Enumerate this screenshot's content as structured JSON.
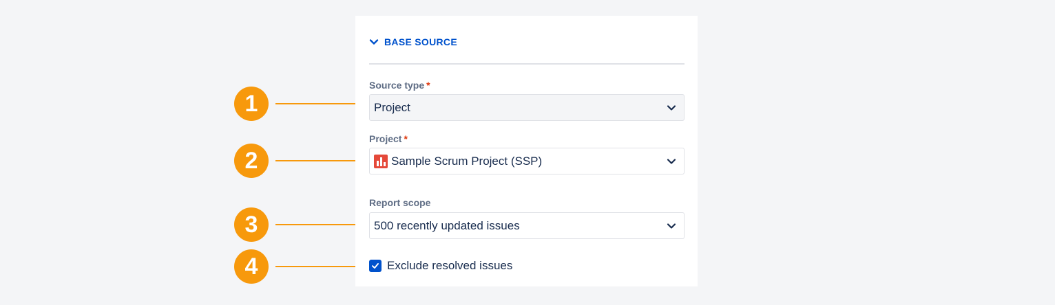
{
  "section": {
    "title": "BASE SOURCE",
    "expanded": true,
    "accent_color": "#0052cc"
  },
  "fields": {
    "source_type": {
      "label": "Source type",
      "required_mark": "*",
      "value": "Project"
    },
    "project": {
      "label": "Project",
      "required_mark": "*",
      "value": "Sample Scrum Project (SSP)",
      "icon": "project-avatar-icon"
    },
    "report_scope": {
      "label": "Report scope",
      "value": "500 recently updated issues"
    },
    "exclude_resolved": {
      "label": "Exclude resolved issues",
      "checked": true
    }
  },
  "callouts": [
    {
      "number": "1"
    },
    {
      "number": "2"
    },
    {
      "number": "3"
    },
    {
      "number": "4"
    }
  ],
  "colors": {
    "callout": "#f7990c",
    "required": "#de350b",
    "background": "#f4f5f7"
  }
}
